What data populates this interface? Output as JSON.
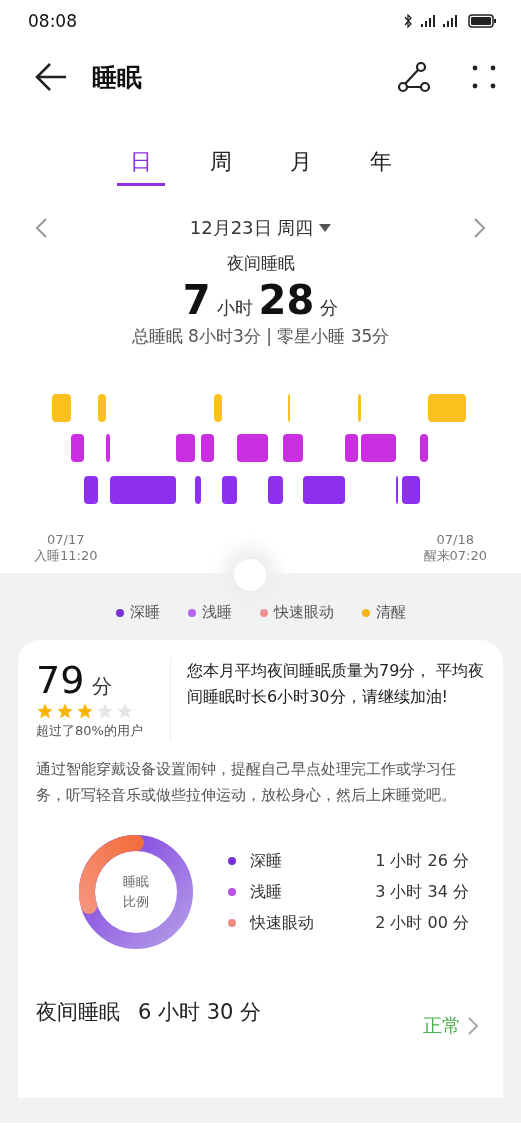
{
  "status_bar": {
    "time": "08:08"
  },
  "header": {
    "title": "睡眠"
  },
  "tabs": [
    {
      "label": "日",
      "selected": true
    },
    {
      "label": "周",
      "selected": false
    },
    {
      "label": "月",
      "selected": false
    },
    {
      "label": "年",
      "selected": false
    }
  ],
  "date": "12月23日 周四",
  "night_sleep": {
    "label": "夜间睡眠",
    "hours": "7",
    "hours_unit": "小时",
    "minutes": "28",
    "minutes_unit": "分"
  },
  "summary": "总睡眠 8小时3分 | 零星小睡 35分",
  "timeline": {
    "start_date": "07/17",
    "start_label": "入睡11:20",
    "end_date": "07/18",
    "end_label": "醒来07:20"
  },
  "legend": [
    {
      "label": "深睡",
      "color": "#7b2fd6"
    },
    {
      "label": "浅睡",
      "color": "#b565ee"
    },
    {
      "label": "快速眼动",
      "color": "#f08b8b"
    },
    {
      "label": "清醒",
      "color": "#f5b716"
    }
  ],
  "score": {
    "value": "79",
    "unit": "分",
    "stars": 3,
    "note": "超过了80%的用户",
    "message": "您本月平均夜间睡眠质量为79分， 平均夜间睡眠时长6小时30分，请继续加油!"
  },
  "tip": "通过智能穿戴设备设置闹钟，提醒自己早点处理完工作或学习任务，听写轻音乐或做些拉伸运动，放松身心，然后上床睡觉吧。",
  "ratio": {
    "label": "睡眠比例",
    "rows": [
      {
        "label": "深睡",
        "color": "#7b2fd6",
        "value": "1 小时 26 分"
      },
      {
        "label": "浅睡",
        "color": "#b84fe0",
        "value": "3 小时 34 分"
      },
      {
        "label": "快速眼动",
        "color": "#f08b80",
        "value": "2 小时 00 分"
      }
    ]
  },
  "night_row": {
    "label": "夜间睡眠",
    "value": "6 小时 30 分",
    "status": "正常"
  }
}
